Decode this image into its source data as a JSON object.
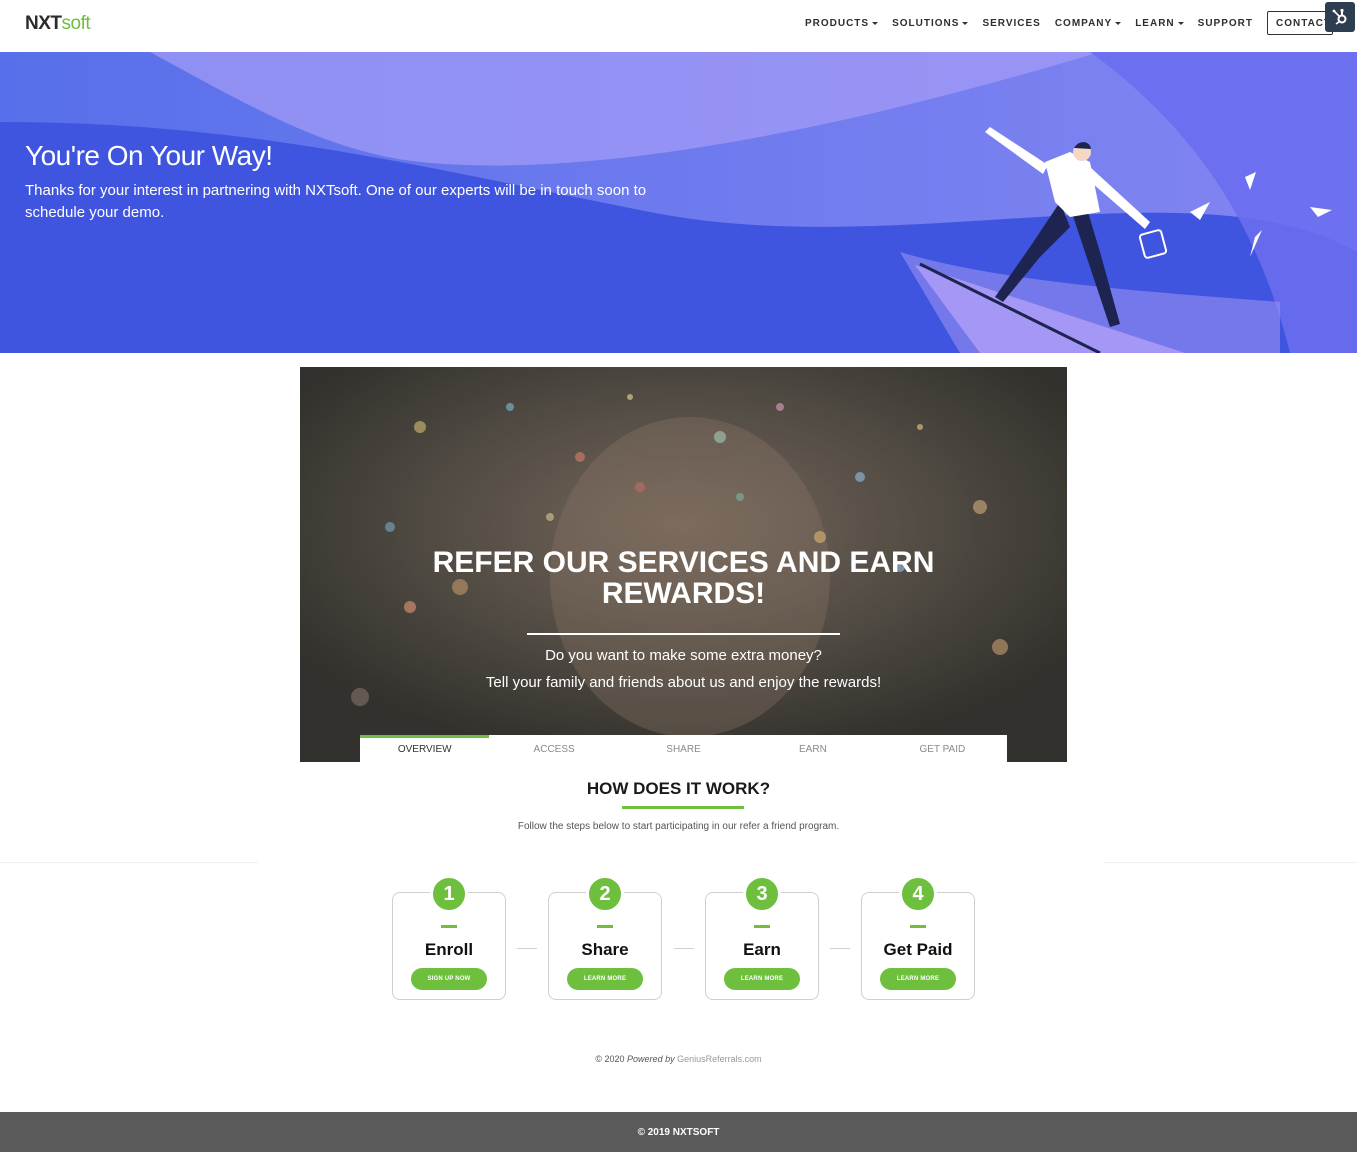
{
  "nav": {
    "logo_nxt": "NXT",
    "logo_soft": "soft",
    "items": [
      {
        "label": "PRODUCTS",
        "dropdown": true
      },
      {
        "label": "SOLUTIONS",
        "dropdown": true
      },
      {
        "label": "SERVICES",
        "dropdown": false
      },
      {
        "label": "COMPANY",
        "dropdown": true
      },
      {
        "label": "LEARN",
        "dropdown": true
      },
      {
        "label": "SUPPORT",
        "dropdown": false
      }
    ],
    "contact_label": "CONTACT"
  },
  "hero": {
    "title": "You're On Your Way!",
    "text": "Thanks for your interest in partnering with NXTsoft. One of our experts will be in touch soon to schedule your demo."
  },
  "banner": {
    "title": "REFER OUR SERVICES AND EARN REWARDS!",
    "question": "Do you want to make some extra money?",
    "subtitle": "Tell your family and friends about us and enjoy the rewards!"
  },
  "tabs": [
    {
      "label": "OVERVIEW",
      "active": true
    },
    {
      "label": "ACCESS",
      "active": false
    },
    {
      "label": "SHARE",
      "active": false
    },
    {
      "label": "EARN",
      "active": false
    },
    {
      "label": "GET PAID",
      "active": false
    }
  ],
  "how": {
    "title": "HOW DOES IT WORK?",
    "subtitle": "Follow the steps below to start participating in our refer a friend program."
  },
  "steps": [
    {
      "number": "1",
      "label": "Enroll",
      "button": "SIGN UP NOW"
    },
    {
      "number": "2",
      "label": "Share",
      "button": "LEARN MORE"
    },
    {
      "number": "3",
      "label": "Earn",
      "button": "LEARN MORE"
    },
    {
      "number": "4",
      "label": "Get Paid",
      "button": "LEARN MORE"
    }
  ],
  "powered": {
    "copy": "© 2020",
    "by": "Powered by",
    "brand": "GeniusReferrals.com"
  },
  "footer": {
    "text": "© 2019 NXTSOFT"
  },
  "colors": {
    "accent_green": "#6fbf3f",
    "hero_blue": "#4c63e6",
    "footer_gray": "#5a5a5a"
  },
  "icons": {
    "hubspot": "hubspot-sprocket-icon"
  }
}
